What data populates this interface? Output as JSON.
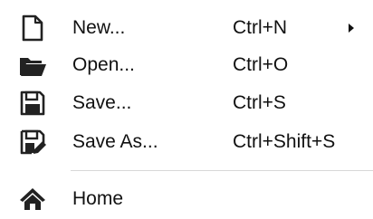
{
  "menu": {
    "items": [
      {
        "label": "New...",
        "shortcut": "Ctrl+N",
        "icon": "new-document-icon",
        "has_submenu": true
      },
      {
        "label": "Open...",
        "shortcut": "Ctrl+O",
        "icon": "folder-open-icon",
        "has_submenu": false
      },
      {
        "label": "Save...",
        "shortcut": "Ctrl+S",
        "icon": "save-icon",
        "has_submenu": false
      },
      {
        "label": "Save As...",
        "shortcut": "Ctrl+Shift+S",
        "icon": "save-as-icon",
        "has_submenu": false
      }
    ],
    "home": {
      "label": "Home",
      "icon": "home-icon"
    }
  },
  "colors": {
    "text": "#111111",
    "icon": "#222222",
    "separator": "#d8d8d8",
    "background": "#ffffff"
  }
}
